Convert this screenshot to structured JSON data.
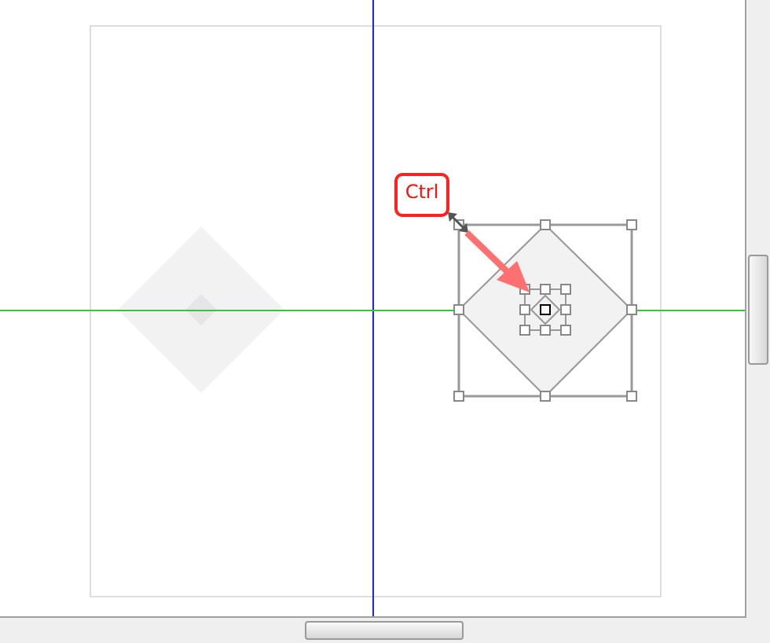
{
  "ctrl_key": {
    "label": "Ctrl"
  }
}
